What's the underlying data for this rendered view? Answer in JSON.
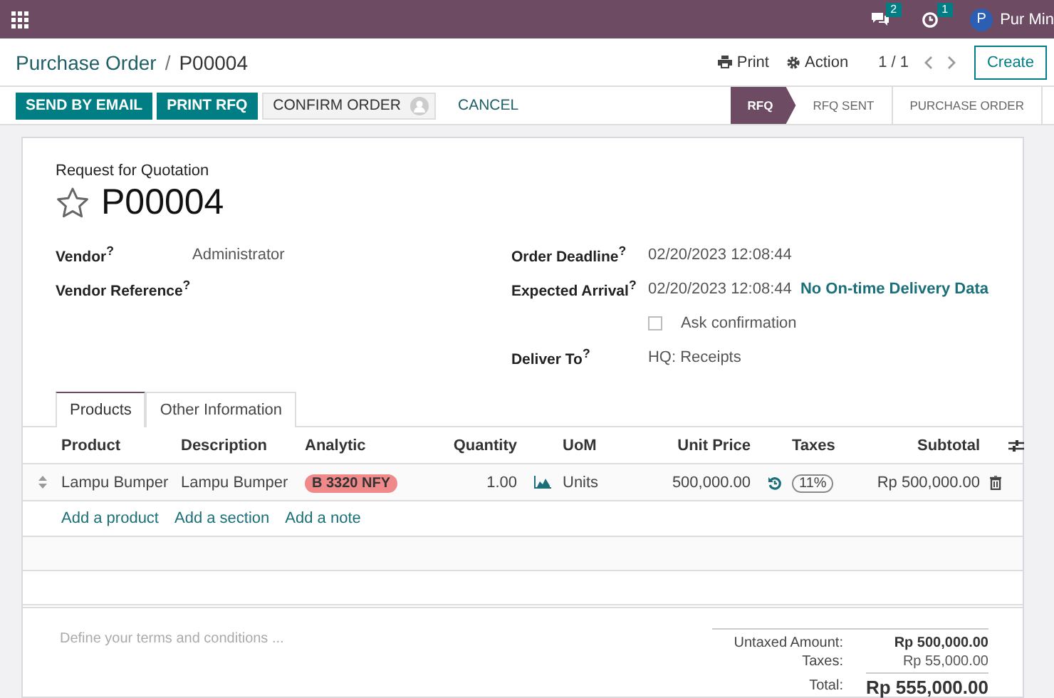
{
  "top_bar": {
    "notifications": [
      {
        "kind": "messages",
        "count": "2"
      },
      {
        "kind": "activities",
        "count": "1"
      }
    ],
    "user": {
      "initial": "P",
      "name": "Pur Min"
    }
  },
  "breadcrumb": {
    "parent": "Purchase Order",
    "separator": "/",
    "current": "P00004"
  },
  "toolbar": {
    "print": "Print",
    "action": "Action",
    "pager": "1 / 1",
    "create": "Create"
  },
  "actions": [
    {
      "label": "SEND BY EMAIL",
      "kind": "primary"
    },
    {
      "label": "PRINT RFQ",
      "kind": "primary"
    },
    {
      "label": "CONFIRM ORDER",
      "kind": "secondary"
    },
    {
      "label": "CANCEL",
      "kind": "link"
    }
  ],
  "status_steps": [
    {
      "label": "RFQ",
      "selected": true
    },
    {
      "label": "RFQ SENT",
      "selected": false
    },
    {
      "label": "PURCHASE ORDER",
      "selected": false
    }
  ],
  "form": {
    "subtitle": "Request for Quotation",
    "starred": false,
    "name": "P00004",
    "left_fields": [
      {
        "label": "Vendor$^{?}$",
        "value": "Administrator"
      },
      {
        "label": "Vendor Reference$^{?}$"
      }
    ],
    "right_fields": [
      {
        "label": "Order Deadline$^{?}$",
        "value": "02/20/2023 12:08:44"
      },
      {
        "label": "Expected Arrival$^{?}$",
        "value": "02/20/2023 12:08:44",
        "note": "No On-time Delivery Data"
      },
      {
        "kind": "checkbox",
        "label": "Ask confirmation",
        "checked": false
      },
      {
        "label": "Deliver To$^{?}$",
        "value": "HQ: Receipts"
      }
    ]
  },
  "tabs": [
    {
      "label": "Products",
      "selected": true
    },
    {
      "label": "Other Information",
      "selected": false
    }
  ],
  "table": {
    "columns": [
      "Product",
      "Description",
      "Analytic",
      "Quantity",
      "UoM",
      "Unit Price",
      "Taxes",
      "Subtotal"
    ],
    "rows": [
      {
        "product": "Lampu Bumper",
        "description": "Lampu Bumper",
        "analytic": "B 3320 NFY",
        "quantity": "1.00",
        "uom": "Units",
        "unit_price": "500,000.00",
        "taxes": "11%",
        "subtotal": "Rp 500,000.00"
      }
    ],
    "add_links": [
      "Add a product",
      "Add a section",
      "Add a note"
    ]
  },
  "terms": {
    "placeholder": "Define your terms and conditions ..."
  },
  "totals": {
    "untaxed_label": "Untaxed Amount:",
    "untaxed": "Rp 500,000.00",
    "taxes_label": "Taxes:",
    "taxes": "Rp 55,000.00",
    "total_label": "Total:",
    "total": "Rp 555,000.00"
  }
}
